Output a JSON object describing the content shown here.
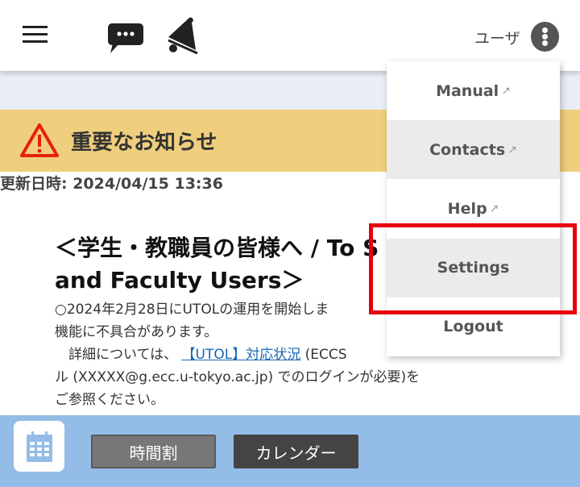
{
  "header": {
    "user_label": "ユーザ"
  },
  "notice": {
    "banner_title": "重要なお知らせ",
    "updated": "更新日時: 2024/04/15 13:36",
    "title_line1": "＜学生・教職員の皆様へ / To S",
    "title_line2": "and Faculty Users＞",
    "p1": "○2024年2月28日にUTOLの運用を開始しま",
    "p1b": "機能に不具合があります。",
    "p2a": "　詳細については、",
    "p2_link": "【UTOL】対応状況",
    "p2b": " (ECCS",
    "p2c": "ル (XXXXX@g.ecc.u-tokyo.ac.jp) でのログインが必要)を",
    "p2d": "ご参照ください。"
  },
  "menu": {
    "items": [
      {
        "label": "Manual",
        "external": true
      },
      {
        "label": "Contacts",
        "external": true
      },
      {
        "label": "Help",
        "external": true
      },
      {
        "label": "Settings",
        "external": false
      },
      {
        "label": "Logout",
        "external": false
      }
    ],
    "ext_glyph": "↗"
  },
  "bottom": {
    "timetable": "時間割",
    "calendar": "カレンダー"
  },
  "colors": {
    "banner": "#efcf7d",
    "bottom_bar": "#93bde6",
    "highlight": "#e8000a"
  }
}
